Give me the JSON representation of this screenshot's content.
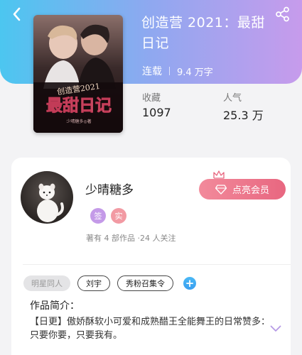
{
  "header": {
    "back_icon": "chevron-left-icon",
    "share_icon": "share-icon",
    "gradient": [
      "#4cc6f0",
      "#8fa8f0",
      "#c79bec"
    ]
  },
  "book": {
    "title": "创造营 2021：最甜日记",
    "cover_title_top": "创造营2021",
    "cover_title_main": "最甜日记",
    "cover_author": "少晴糖多◎著",
    "status": "连载",
    "word_count": "9.4 万字",
    "stats": [
      {
        "label": "收藏",
        "value": "1097"
      },
      {
        "label": "人气",
        "value": "25.3 万"
      }
    ]
  },
  "author": {
    "name": "少晴糖多",
    "badges": [
      {
        "label": "签",
        "color": "#c49ae8"
      },
      {
        "label": "实",
        "color": "#f29aa3"
      }
    ],
    "works_info": "著有 4 部作品 ·24 人关注",
    "vip_button": "点亮会员",
    "vip_color": "#e86780"
  },
  "tags": [
    "明星同人",
    "刘宇",
    "秀粉召集令"
  ],
  "intro": {
    "title": "作品简介：",
    "text": "【日更】傲娇酥软小可爱和成熟醋王全能舞王的日常赞多：只要你要，只要我有。"
  }
}
